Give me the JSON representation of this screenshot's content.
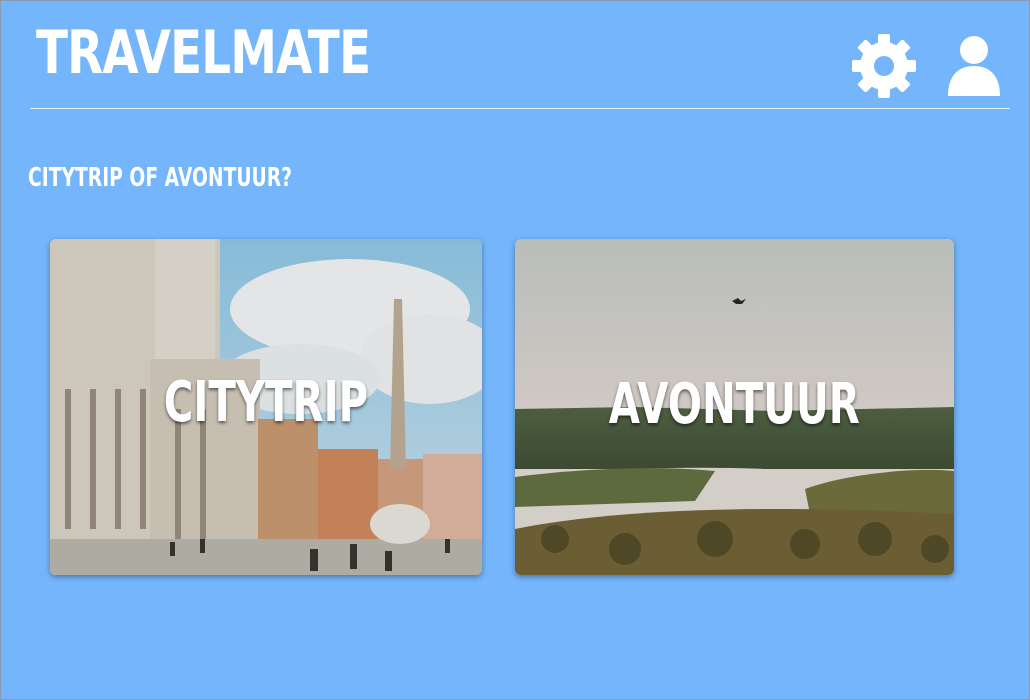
{
  "app": {
    "title": "TRAVELMATE"
  },
  "header": {
    "icons": [
      "gear-icon",
      "user-icon"
    ]
  },
  "main": {
    "question": "CITYTRIP OF AVONTUUR?",
    "cards": [
      {
        "label": "CITYTRIP"
      },
      {
        "label": "AVONTUUR"
      }
    ]
  },
  "colors": {
    "background": "#74b5fb",
    "text": "#ffffff"
  }
}
